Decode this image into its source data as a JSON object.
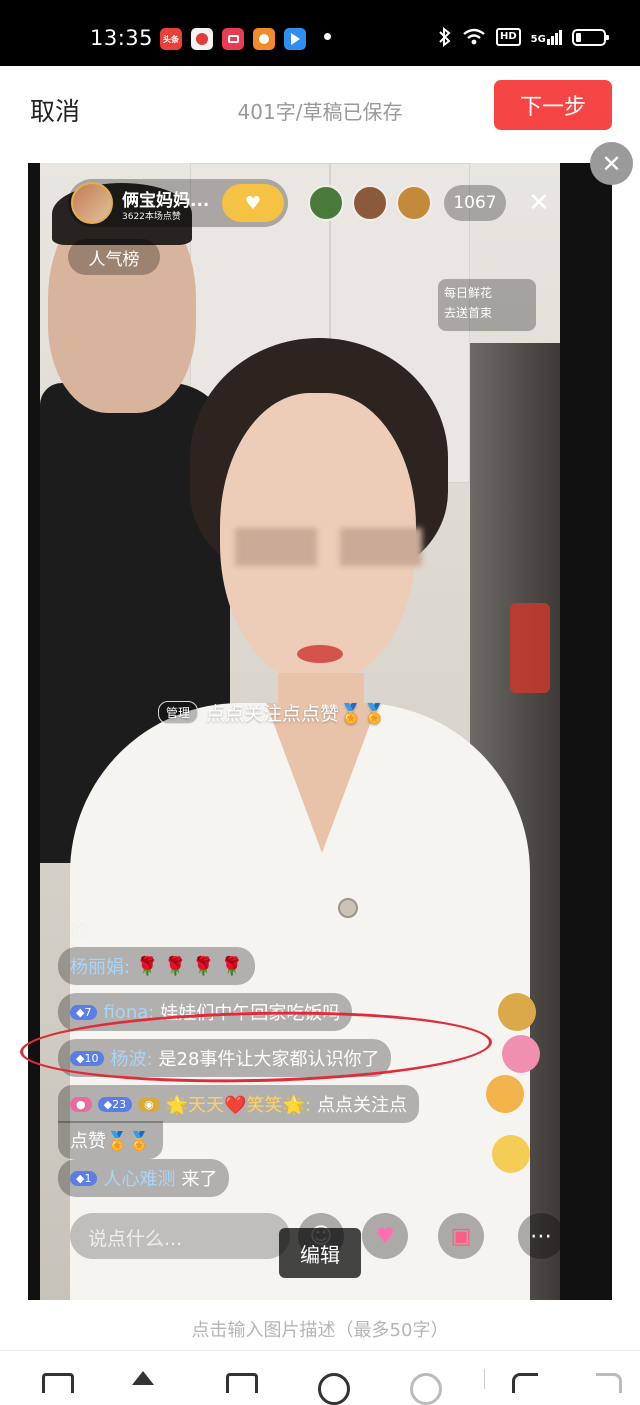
{
  "status_bar": {
    "time": "13:35",
    "app_icons": [
      "头条",
      "video",
      "camera",
      "weibo",
      "player"
    ],
    "network": "HD",
    "signal": "5G"
  },
  "header": {
    "cancel_label": "取消",
    "draft_status": "401字/草稿已保存",
    "next_label": "下一步"
  },
  "live": {
    "host_name": "俩宝妈妈...",
    "host_sub": "3622本场点赞",
    "popular_label": "人气榜",
    "viewer_count": "1067",
    "flower_line1": "每日鲜花",
    "flower_line2": "去送首束",
    "admin_tag": "管理",
    "admin_msg": "点点关注点点赞🏅🏅",
    "truncated": "的",
    "comments": [
      {
        "name": "杨丽娟:",
        "text": "🌹 🌹 🌹 🌹",
        "level": ""
      },
      {
        "name": "fiona:",
        "text": "娃娃们中午回家吃饭吗",
        "level": "7"
      },
      {
        "name": "杨波:",
        "text": "是28事件让大家都认识你了",
        "level": "10"
      },
      {
        "name": "🌟天天❤️笑笑🌟:",
        "text": "点点关注点",
        "level": "23"
      },
      {
        "name": "",
        "text": "点赞🏅🏅",
        "level": ""
      },
      {
        "name": "人心难测",
        "text": "来了",
        "level": "1"
      }
    ],
    "say_placeholder": "说点什么...",
    "edit_label": "编辑"
  },
  "caption_placeholder": "点击输入图片描述（最多50字）",
  "accent_color": "#f54545"
}
